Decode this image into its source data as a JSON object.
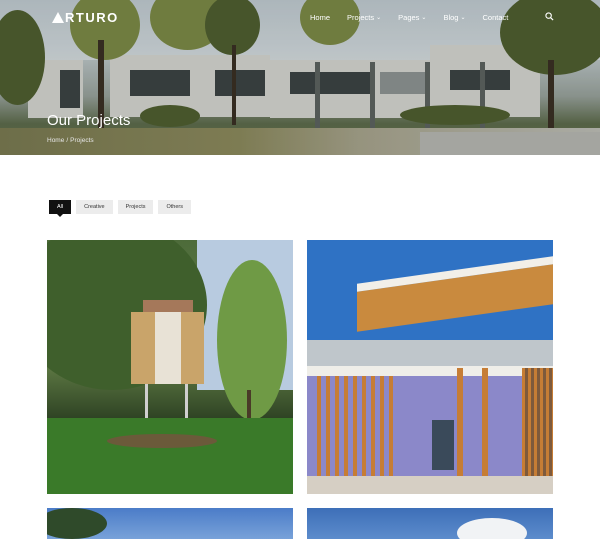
{
  "header": {
    "logo": "RTURO",
    "nav": [
      {
        "label": "Home",
        "has_dropdown": false
      },
      {
        "label": "Projects",
        "has_dropdown": true
      },
      {
        "label": "Pages",
        "has_dropdown": true
      },
      {
        "label": "Blog",
        "has_dropdown": true
      },
      {
        "label": "Contact",
        "has_dropdown": false
      }
    ],
    "search_icon": "search-icon"
  },
  "hero": {
    "title": "Our Projects",
    "breadcrumb": [
      "Home",
      "Projects"
    ]
  },
  "filters": {
    "items": [
      "All",
      "Creative",
      "Projects",
      "Others"
    ],
    "active": "All"
  },
  "colors": {
    "accent": "#111111",
    "filter_bg": "#ececec",
    "sky_blue": "#2f72c4"
  }
}
